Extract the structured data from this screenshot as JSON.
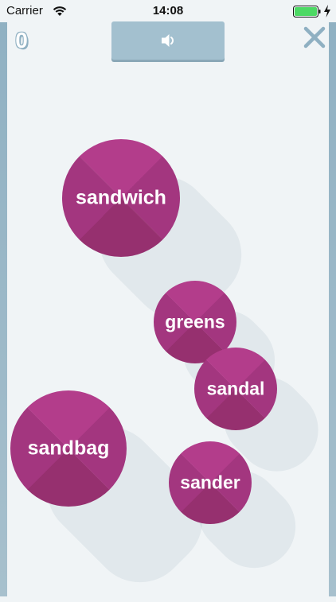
{
  "status_bar": {
    "carrier": "Carrier",
    "time": "14:08",
    "wifi_icon": "wifi-icon",
    "battery_icon": "battery-full-icon",
    "charging_icon": "charging-bolt-icon"
  },
  "header": {
    "score": "0",
    "sound_button_icon": "speaker-icon",
    "close_icon": "close-icon"
  },
  "bubbles": [
    {
      "word": "sandwich"
    },
    {
      "word": "greens"
    },
    {
      "word": "sandal"
    },
    {
      "word": "sandbag"
    },
    {
      "word": "sander"
    }
  ],
  "colors": {
    "background": "#f0f4f6",
    "frame": "#a3c0cf",
    "bubble": "#a3367f",
    "bubble_light": "#b33d8b",
    "bubble_dark": "#96306f",
    "battery": "#4cd964",
    "close_icon": "#8fb0c2"
  }
}
